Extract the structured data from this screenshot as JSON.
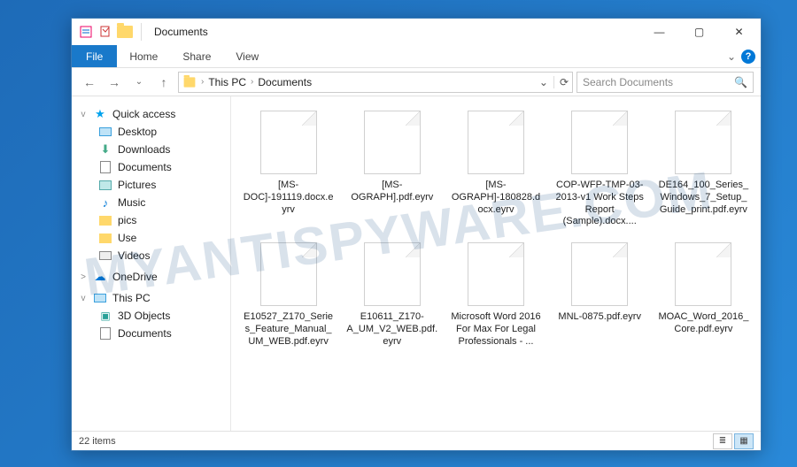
{
  "window": {
    "title": "Documents"
  },
  "title_icons": {
    "icon1": "properties-icon",
    "icon2": "copy-icon",
    "icon3": "folder-icon"
  },
  "controls": {
    "min": "—",
    "max": "▢",
    "close": "✕"
  },
  "ribbon": {
    "file": "File",
    "home": "Home",
    "share": "Share",
    "view": "View",
    "collapse": "⌄",
    "help": "?"
  },
  "nav": {
    "back": "←",
    "forward": "→",
    "up": "↑",
    "history": "⌄"
  },
  "breadcrumb": {
    "root_icon": "›",
    "items": [
      "This PC",
      "Documents"
    ],
    "dropdown": "⌄",
    "refresh": "⟳"
  },
  "search": {
    "placeholder": "Search Documents",
    "icon": "🔍"
  },
  "sidebar": {
    "quick_access": {
      "label": "Quick access",
      "chev": "v"
    },
    "items": [
      {
        "label": "Desktop",
        "icon": "desktop"
      },
      {
        "label": "Downloads",
        "icon": "down"
      },
      {
        "label": "Documents",
        "icon": "doc"
      },
      {
        "label": "Pictures",
        "icon": "pic"
      },
      {
        "label": "Music",
        "icon": "music"
      },
      {
        "label": "pics",
        "icon": "folder"
      },
      {
        "label": "Use",
        "icon": "folder"
      },
      {
        "label": "Videos",
        "icon": "video"
      }
    ],
    "onedrive": {
      "label": "OneDrive",
      "chev": ">"
    },
    "thispc": {
      "label": "This PC",
      "chev": "v"
    },
    "pc_items": [
      {
        "label": "3D Objects",
        "icon": "3d"
      },
      {
        "label": "Documents",
        "icon": "doc"
      }
    ]
  },
  "files": [
    {
      "name": "[MS-DOC]-191119.docx.eyrv"
    },
    {
      "name": "[MS-OGRAPH].pdf.eyrv"
    },
    {
      "name": "[MS-OGRAPH]-180828.docx.eyrv"
    },
    {
      "name": "COP-WFP-TMP-03-2013-v1 Work Steps Report (Sample).docx...."
    },
    {
      "name": "DE164_100_Series_Windows_7_Setup_Guide_print.pdf.eyrv"
    },
    {
      "name": "E10527_Z170_Series_Feature_Manual_UM_WEB.pdf.eyrv"
    },
    {
      "name": "E10611_Z170-A_UM_V2_WEB.pdf.eyrv"
    },
    {
      "name": "Microsoft Word 2016 For Max For Legal Professionals - ..."
    },
    {
      "name": "MNL-0875.pdf.eyrv"
    },
    {
      "name": "MOAC_Word_2016_Core.pdf.eyrv"
    }
  ],
  "status": {
    "count": "22 items",
    "view_list": "≣",
    "view_icons": "▦"
  },
  "watermark": "MYANTISPYWARE.COM"
}
